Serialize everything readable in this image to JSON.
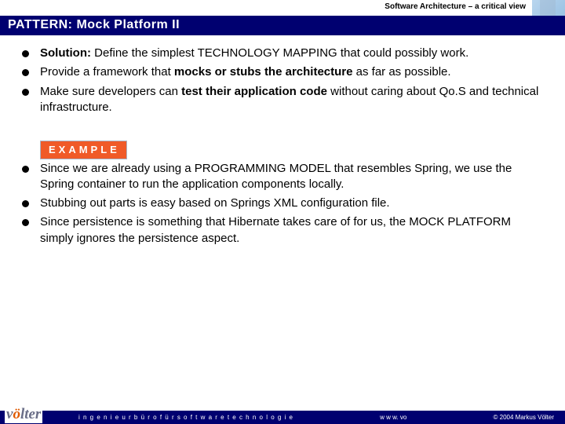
{
  "header": {
    "doc_title": "Software Architecture – a critical view"
  },
  "title": "PATTERN: Mock Platform II",
  "bullets_top": [
    {
      "pre": "",
      "bold1": "Solution:",
      "mid": " Define the simplest TECHNOLOGY MAPPING that could possibly work.",
      "bold2": "",
      "post": ""
    },
    {
      "pre": "Provide a framework that ",
      "bold1": "mocks or stubs the architecture",
      "mid": " as far as possible.",
      "bold2": "",
      "post": ""
    },
    {
      "pre": "Make sure developers can ",
      "bold1": "test their application code",
      "mid": " without caring about Qo.S and technical infrastructure.",
      "bold2": "",
      "post": ""
    }
  ],
  "example_label": "EXAMPLE",
  "bullets_bottom": [
    "Since we are already using a PROGRAMMING MODEL that resembles Spring, we use the Spring container to run the application components locally.",
    "Stubbing out parts is easy based on Springs XML configuration file.",
    "Since persistence is something that Hibernate takes care of for us, the MOCK PLATFORM simply ignores the persistence aspect."
  ],
  "footer": {
    "logo_main": "v",
    "logo_dot": "ö",
    "logo_rest": "lter",
    "tagline": "i n g e n i e u r b ü r o   f ü r   s o f t w a r e t e c h n o l o g i e",
    "url": "w w w. vo",
    "copyright": "© 2004  Markus Völter"
  }
}
